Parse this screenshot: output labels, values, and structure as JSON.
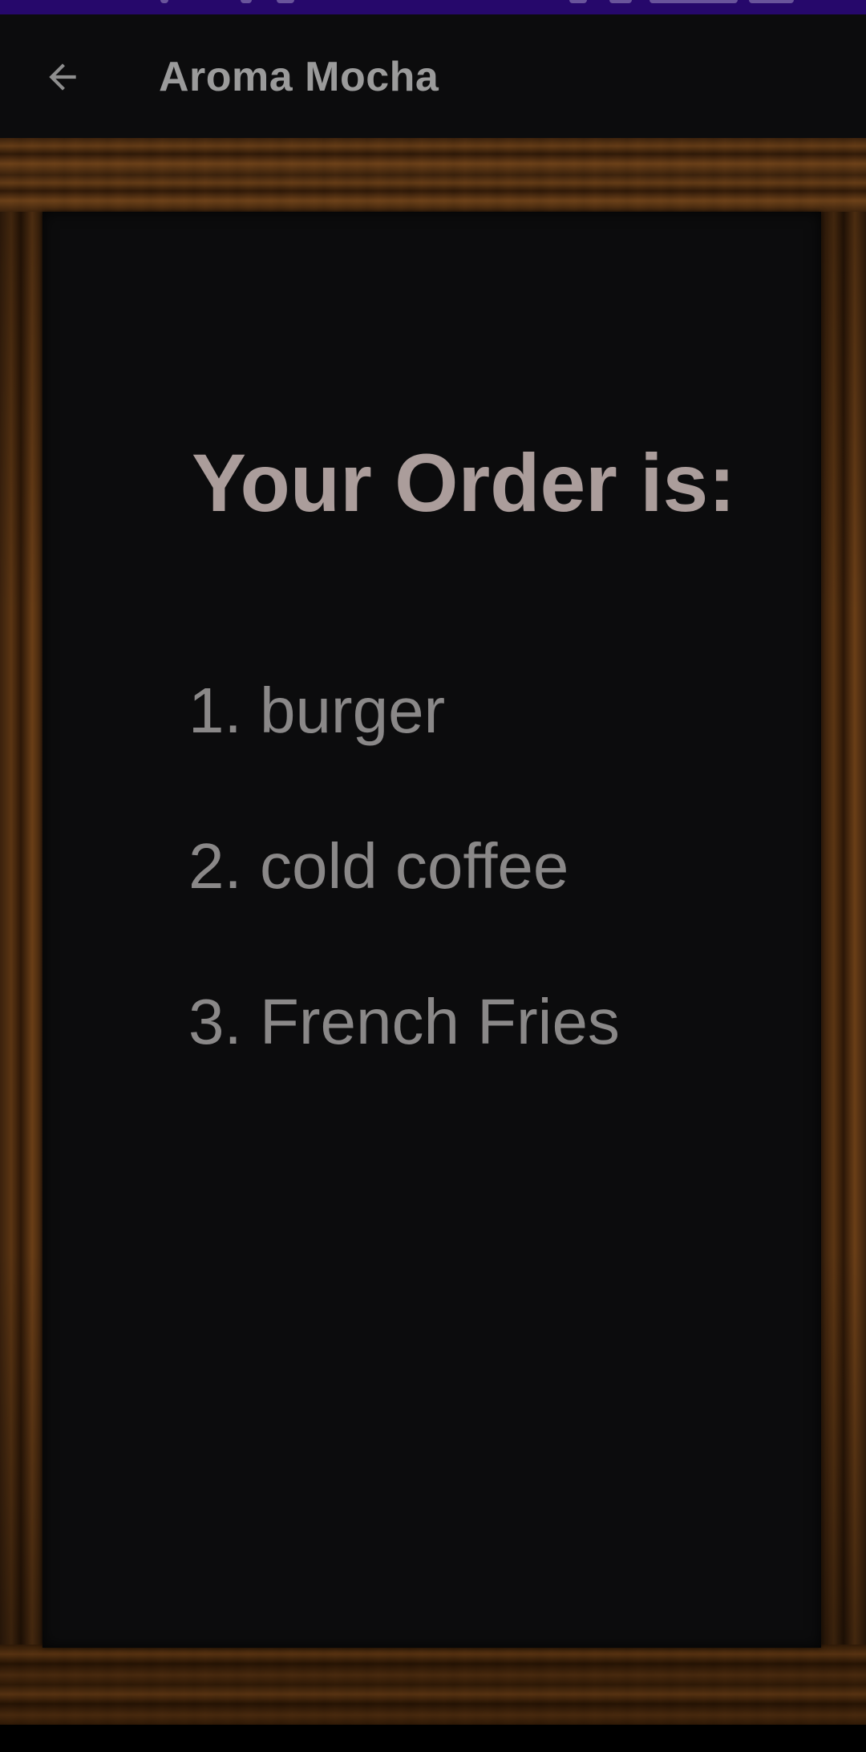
{
  "app_bar": {
    "title": "Aroma Mocha",
    "back_icon": "arrow-left-icon"
  },
  "order": {
    "heading": "Your Order is:",
    "items": [
      "1. burger",
      "2. cold coffee",
      "3. French Fries"
    ]
  },
  "colors": {
    "status_bar": "#26086b",
    "app_bar": "#0c0c0d",
    "blackboard": "#0c0c0d",
    "frame_wood": "#4a2a10",
    "heading_text": "#ab9d9b",
    "item_text": "#8a8888",
    "title_text": "#9b9b9b"
  }
}
